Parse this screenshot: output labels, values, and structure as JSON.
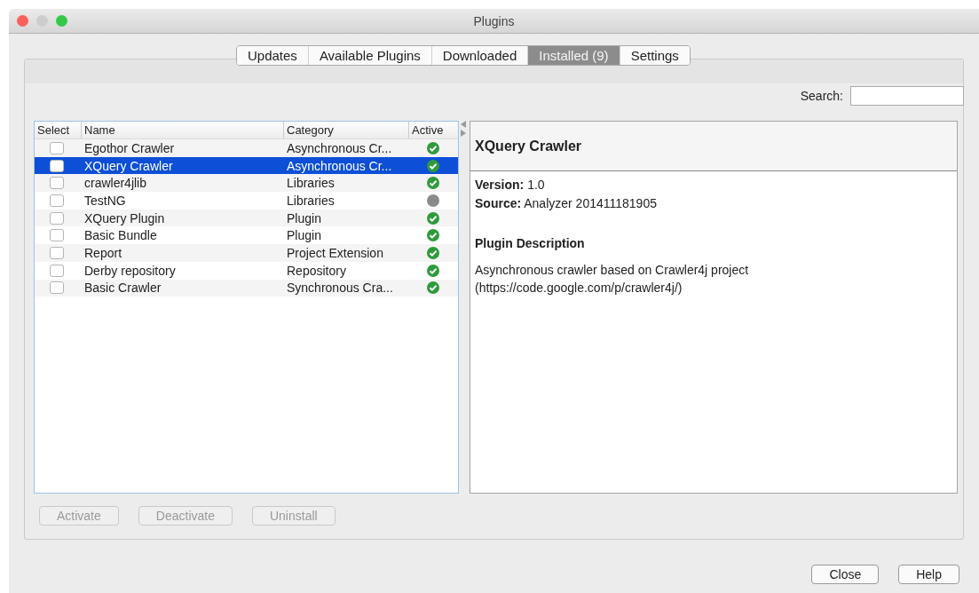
{
  "window": {
    "title": "Plugins"
  },
  "tabs": [
    {
      "label": "Updates",
      "selected": false
    },
    {
      "label": "Available Plugins",
      "selected": false
    },
    {
      "label": "Downloaded",
      "selected": false
    },
    {
      "label": "Installed (9)",
      "selected": true
    },
    {
      "label": "Settings",
      "selected": false
    }
  ],
  "search": {
    "label": "Search:"
  },
  "table": {
    "columns": [
      "Select",
      "Name",
      "Category",
      "Active"
    ],
    "rows": [
      {
        "checked": false,
        "name": "Egothor Crawler",
        "category": "Asynchronous Cr...",
        "active": true,
        "selected": false
      },
      {
        "checked": false,
        "name": "XQuery Crawler",
        "category": "Asynchronous Cr...",
        "active": true,
        "selected": true
      },
      {
        "checked": false,
        "name": "crawler4jlib",
        "category": "Libraries",
        "active": true,
        "selected": false
      },
      {
        "checked": false,
        "name": "TestNG",
        "category": "Libraries",
        "active": false,
        "selected": false
      },
      {
        "checked": false,
        "name": "XQuery Plugin",
        "category": "Plugin",
        "active": true,
        "selected": false
      },
      {
        "checked": false,
        "name": "Basic Bundle",
        "category": "Plugin",
        "active": true,
        "selected": false
      },
      {
        "checked": false,
        "name": "Report",
        "category": "Project Extension",
        "active": true,
        "selected": false
      },
      {
        "checked": false,
        "name": "Derby repository",
        "category": "Repository",
        "active": true,
        "selected": false
      },
      {
        "checked": false,
        "name": "Basic Crawler",
        "category": "Synchronous Cra...",
        "active": true,
        "selected": false
      }
    ]
  },
  "details": {
    "title": "XQuery Crawler",
    "lines": [
      "**Version:** 1.0",
      "**Source:** Analyzer 201411181905"
    ],
    "heading": "Plugin Description",
    "description": "Asynchronous crawler based on Crawler4j project\n(https://code.google.com/p/crawler4j/)"
  },
  "actions": [
    {
      "label": "Activate",
      "disabled": true
    },
    {
      "label": "Deactivate",
      "disabled": true
    },
    {
      "label": "Uninstall",
      "disabled": true
    }
  ],
  "footer_buttons": [
    {
      "label": "Close",
      "disabled": false
    },
    {
      "label": "Help",
      "disabled": false
    }
  ]
}
